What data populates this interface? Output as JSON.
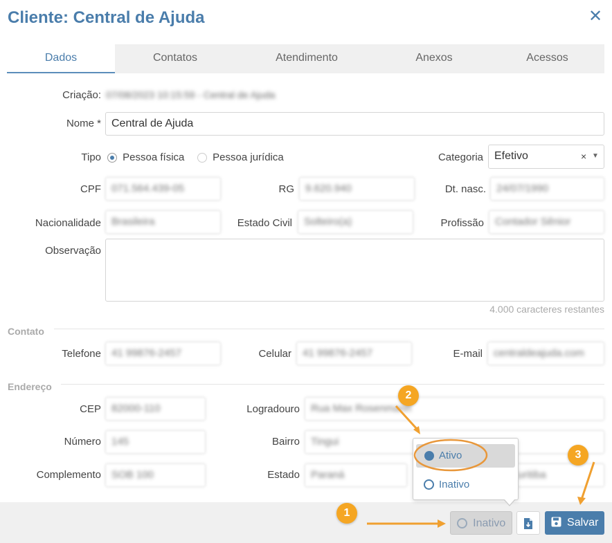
{
  "dialog": {
    "title": "Cliente: Central de Ajuda"
  },
  "tabs": [
    {
      "label": "Dados"
    },
    {
      "label": "Contatos"
    },
    {
      "label": "Atendimento"
    },
    {
      "label": "Anexos"
    },
    {
      "label": "Acessos"
    }
  ],
  "form": {
    "criacao_label": "Criação:",
    "criacao_value": "07/08/2023 10:15:59 - Central de Ajuda",
    "nome_label": "Nome *",
    "nome_value": "Central de Ajuda",
    "tipo_label": "Tipo",
    "tipo_option_1": "Pessoa física",
    "tipo_option_2": "Pessoa jurídica",
    "categoria_label": "Categoria",
    "categoria_value": "Efetivo",
    "clear_glyph": "×",
    "cpf_label": "CPF",
    "cpf_value": "071.564.439-05",
    "rg_label": "RG",
    "rg_value": "9.620.940",
    "dtnasc_label": "Dt. nasc.",
    "dtnasc_value": "24/07/1990",
    "nacionalidade_label": "Nacionalidade",
    "nacionalidade_value": "Brasileira",
    "estado_civil_label": "Estado Civil",
    "estado_civil_value": "Solteiro(a)",
    "profissao_label": "Profissão",
    "profissao_value": "Contador Sênior",
    "observacao_label": "Observação",
    "observacao_value": "",
    "observacao_counter": "4.000 caracteres restantes"
  },
  "contato": {
    "section_label": "Contato",
    "telefone_label": "Telefone",
    "telefone_value": "41 99876-2457",
    "celular_label": "Celular",
    "celular_value": "41 99876-2457",
    "email_label": "E-mail",
    "email_value": "centraldeajuda.com"
  },
  "endereco": {
    "section_label": "Endereço",
    "cep_label": "CEP",
    "cep_value": "82000-110",
    "logradouro_label": "Logradouro",
    "logradouro_value": "Rua Max Rosenmann",
    "numero_label": "Número",
    "numero_value": "145",
    "bairro_label": "Bairro",
    "bairro_value": "Tingui",
    "complemento_label": "Complemento",
    "complemento_value": "SOB 100",
    "estado_label": "Estado",
    "estado_value": "Paraná",
    "cidade_value": "Curitiba"
  },
  "status_popover": {
    "options": [
      {
        "label": "Ativo"
      },
      {
        "label": "Inativo"
      }
    ]
  },
  "footer": {
    "status_button_label": "Inativo",
    "save_button_label": "Salvar"
  },
  "annotations": {
    "badge_1": "1",
    "badge_2": "2",
    "badge_3": "3"
  },
  "colors": {
    "accent": "#4a7dab",
    "save_button": "#4a7dab",
    "badge": "#f5a623",
    "highlight_ring": "#e8973a"
  }
}
